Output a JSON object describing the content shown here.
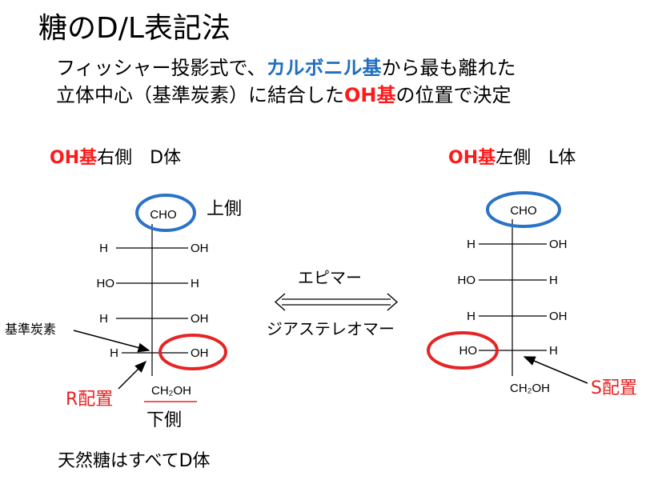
{
  "title": "糖のD/L表記法",
  "description": {
    "line1_pre": "フィッシャー投影式で、",
    "line1_highlight": "カルボニル基",
    "line1_post": "から最も離れた",
    "line2_pre": "立体中心（基準炭素）に結合した",
    "line2_highlight": "OH基",
    "line2_post": "の位置で決定"
  },
  "d_form": {
    "heading_highlight": "OH基",
    "heading_rest": "右側　D体",
    "top_group": "CHO",
    "top_label": "上側",
    "bottom_label": "下側",
    "bottom_group": "CH₂OH",
    "rows": [
      {
        "left": "H",
        "right": "OH"
      },
      {
        "left": "HO",
        "right": "H"
      },
      {
        "left": "H",
        "right": "OH"
      },
      {
        "left": "H",
        "right": "OH"
      }
    ],
    "reference_label": "基準炭素",
    "config_label": "R配置"
  },
  "l_form": {
    "heading_highlight": "OH基",
    "heading_rest": "左側　L体",
    "top_group": "CHO",
    "bottom_group": "CH₂OH",
    "rows": [
      {
        "left": "H",
        "right": "OH"
      },
      {
        "left": "HO",
        "right": "H"
      },
      {
        "left": "H",
        "right": "OH"
      },
      {
        "left": "HO",
        "right": "H"
      }
    ],
    "config_label": "S配置"
  },
  "relation": {
    "top_label": "エピマー",
    "bottom_label": "ジアステレオマー"
  },
  "footer": "天然糖はすべてD体",
  "colors": {
    "blue_accent": "#1f6fc0",
    "red_accent": "#ff1a1a",
    "circle_blue": "#2a73c6",
    "circle_red": "#e62424"
  }
}
